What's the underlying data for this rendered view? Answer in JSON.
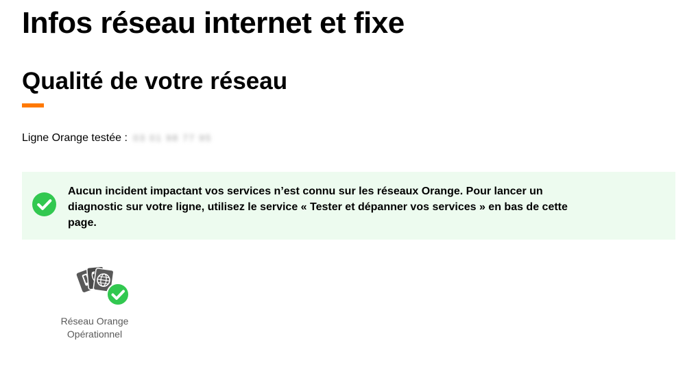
{
  "header": {
    "title": "Infos réseau internet et fixe"
  },
  "section": {
    "title": "Qualité de votre réseau",
    "accent_color": "#ff7900"
  },
  "line": {
    "label": "Ligne Orange testée :",
    "number": "03 01 98 77 95"
  },
  "alert": {
    "message": "Aucun incident impactant vos services n’est connu sur les réseaux Orange. Pour lancer un diagnostic sur votre ligne, utilisez le service « Tester et dépanner vos services » en bas de cette page.",
    "icon": "check-circle-icon",
    "background_color": "#edfbef",
    "icon_color": "#32c850"
  },
  "network_status": {
    "icon": "network-services-check-icon",
    "label_line1": "Réseau Orange",
    "label_line2": "Opérationnel"
  }
}
